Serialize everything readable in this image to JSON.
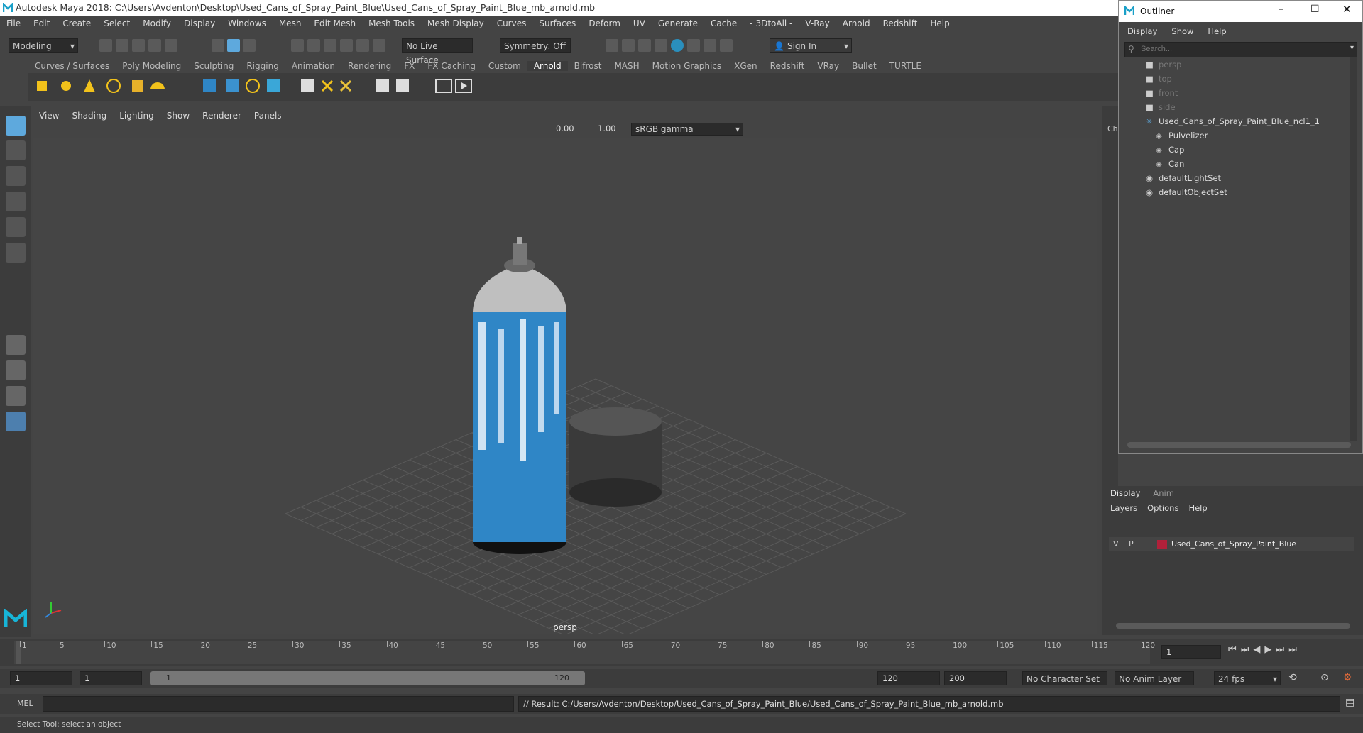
{
  "window": {
    "title": "Autodesk Maya 2018: C:\\Users\\Avdenton\\Desktop\\Used_Cans_of_Spray_Paint_Blue\\Used_Cans_of_Spray_Paint_Blue_mb_arnold.mb"
  },
  "menubar": [
    "File",
    "Edit",
    "Create",
    "Select",
    "Modify",
    "Display",
    "Windows",
    "Mesh",
    "Edit Mesh",
    "Mesh Tools",
    "Mesh Display",
    "Curves",
    "Surfaces",
    "Deform",
    "UV",
    "Generate",
    "Cache",
    "- 3DtoAll -",
    "V-Ray",
    "Arnold",
    "Redshift",
    "Help"
  ],
  "statusline": {
    "mode": "Modeling",
    "live_surface": "No Live Surface",
    "symmetry": "Symmetry: Off",
    "sign_in": "Sign In"
  },
  "shelf_tabs": [
    "Curves / Surfaces",
    "Poly Modeling",
    "Sculpting",
    "Rigging",
    "Animation",
    "Rendering",
    "FX",
    "FX Caching",
    "Custom",
    "Arnold",
    "Bifrost",
    "MASH",
    "Motion Graphics",
    "XGen",
    "Redshift",
    "VRay",
    "Bullet",
    "TURTLE"
  ],
  "shelf_active": "Arnold",
  "panel_menu": [
    "View",
    "Shading",
    "Lighting",
    "Show",
    "Renderer",
    "Panels"
  ],
  "viewport_toolbar": {
    "exposure": "0.00",
    "gamma": "1.00",
    "colorspace": "sRGB gamma"
  },
  "viewport": {
    "camera_label": "persp"
  },
  "outliner": {
    "title": "Outliner",
    "menu": [
      "Display",
      "Show",
      "Help"
    ],
    "search_placeholder": "Search...",
    "items": [
      {
        "label": "persp",
        "icon": "camera-icon",
        "indent": 0,
        "dim": true
      },
      {
        "label": "top",
        "icon": "camera-icon",
        "indent": 0,
        "dim": true
      },
      {
        "label": "front",
        "icon": "camera-icon",
        "indent": 0,
        "dim": true
      },
      {
        "label": "side",
        "icon": "camera-icon",
        "indent": 0,
        "dim": true
      },
      {
        "label": "Used_Cans_of_Spray_Paint_Blue_ncl1_1",
        "icon": "group-icon",
        "indent": 0,
        "dim": false
      },
      {
        "label": "Pulvelizer",
        "icon": "mesh-icon",
        "indent": 1,
        "dim": false
      },
      {
        "label": "Cap",
        "icon": "mesh-icon",
        "indent": 1,
        "dim": false
      },
      {
        "label": "Can",
        "icon": "mesh-icon",
        "indent": 1,
        "dim": false
      },
      {
        "label": "defaultLightSet",
        "icon": "set-icon",
        "indent": 0,
        "dim": false
      },
      {
        "label": "defaultObjectSet",
        "icon": "set-icon",
        "indent": 0,
        "dim": false
      }
    ]
  },
  "channel_tab": "Ch",
  "layer_editor": {
    "tabs": [
      "Display",
      "Anim"
    ],
    "menu": [
      "Layers",
      "Options",
      "Help"
    ],
    "layer": {
      "v": "V",
      "p": "P",
      "name": "Used_Cans_of_Spray_Paint_Blue",
      "color": "#b0213a"
    }
  },
  "timeline": {
    "ticks": [
      1,
      5,
      10,
      15,
      20,
      25,
      30,
      35,
      40,
      45,
      50,
      55,
      60,
      65,
      70,
      75,
      80,
      85,
      90,
      95,
      100,
      105,
      110,
      115,
      120
    ],
    "current_frame": "1"
  },
  "range": {
    "start": "1",
    "anim_start": "1",
    "range_start": "1",
    "range_end": "120",
    "end": "120",
    "anim_end": "200",
    "character_set": "No Character Set",
    "anim_layer": "No Anim Layer",
    "fps": "24 fps"
  },
  "command": {
    "lang": "MEL",
    "result": "// Result: C:/Users/Avdenton/Desktop/Used_Cans_of_Spray_Paint_Blue/Used_Cans_of_Spray_Paint_Blue_mb_arnold.mb"
  },
  "help_line": "Select Tool: select an object",
  "colors": {
    "accent": "#5ea9dd",
    "layer_swatch": "#b0213a",
    "can_blue": "#2f86c6"
  }
}
